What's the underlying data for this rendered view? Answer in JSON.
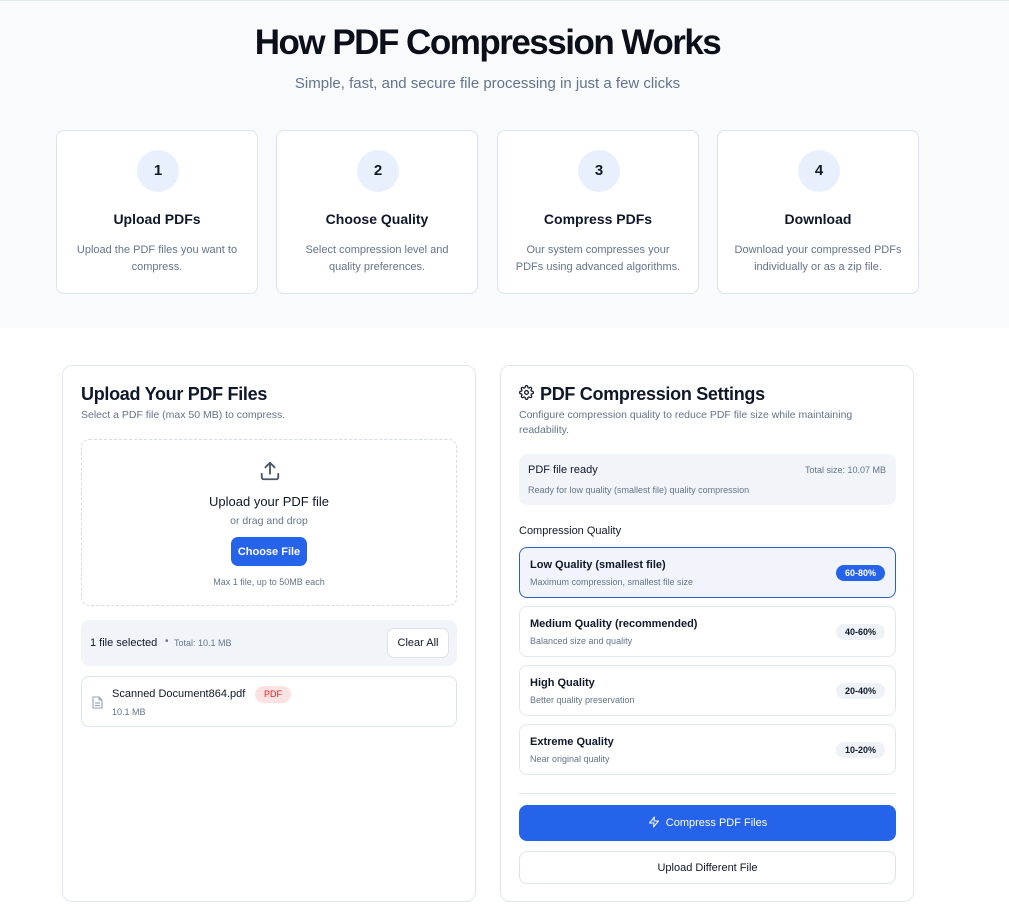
{
  "hero": {
    "title": "How PDF Compression Works",
    "subtitle": "Simple, fast, and secure file processing in just a few clicks",
    "steps": [
      {
        "number": "1",
        "title": "Upload PDFs",
        "description": "Upload the PDF files you want to compress."
      },
      {
        "number": "2",
        "title": "Choose Quality",
        "description": "Select compression level and quality preferences."
      },
      {
        "number": "3",
        "title": "Compress PDFs",
        "description": "Our system compresses your PDFs using advanced algorithms."
      },
      {
        "number": "4",
        "title": "Download",
        "description": "Download your compressed PDFs individually or as a zip file."
      }
    ]
  },
  "upload": {
    "title": "Upload Your PDF Files",
    "subtitle": "Select a PDF file (max 50 MB) to compress.",
    "dropzone_title": "Upload your PDF file",
    "dropzone_or": "or drag and drop",
    "choose_button": "Choose File",
    "max_note": "Max 1 file, up to 50MB each",
    "selected_count": "1 file selected",
    "separator": "•",
    "total": "Total: 10.1 MB",
    "clear_button": "Clear All",
    "file": {
      "name": "Scanned Document864.pdf",
      "type_badge": "PDF",
      "size": "10.1 MB",
      "icon": "file-icon"
    }
  },
  "settings": {
    "title": "PDF Compression Settings",
    "icon": "gear-icon",
    "subtitle": "Configure compression quality to reduce PDF file size while maintaining readability.",
    "ready_title": "PDF file ready",
    "ready_total": "Total size: 10.07 MB",
    "ready_sub": "Ready for low quality (smallest file) quality compression",
    "quality_label": "Compression Quality",
    "options": [
      {
        "title": "Low Quality (smallest file)",
        "description": "Maximum compression, smallest file size",
        "badge": "60-80%",
        "selected": true
      },
      {
        "title": "Medium Quality (recommended)",
        "description": "Balanced size and quality",
        "badge": "40-60%",
        "selected": false
      },
      {
        "title": "High Quality",
        "description": "Better quality preservation",
        "badge": "20-40%",
        "selected": false
      },
      {
        "title": "Extreme Quality",
        "description": "Near original quality",
        "badge": "10-20%",
        "selected": false
      }
    ],
    "compress_button": "Compress PDF Files",
    "compress_icon": "zap-icon",
    "different_button": "Upload Different File"
  },
  "colors": {
    "accent": "#2563eb",
    "hero_bg": "#f8fafc",
    "badge_pdf_bg": "#fde2e2",
    "badge_pdf_text": "#dc2626"
  }
}
